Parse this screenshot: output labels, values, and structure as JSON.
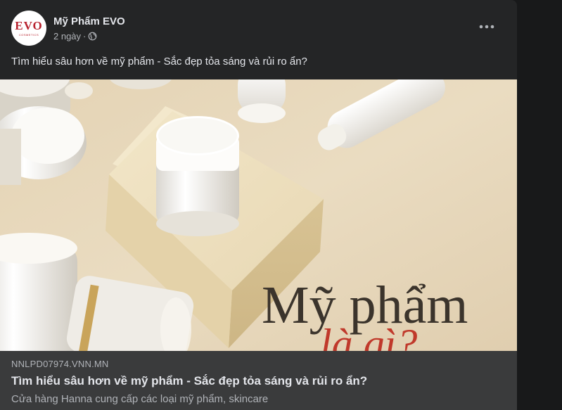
{
  "post": {
    "page_name": "Mỹ Phẩm EVO",
    "time": "2 ngày",
    "separator": "·",
    "audience_icon": "globe-icon",
    "more_icon": "more-horizontal-icon",
    "text": "Tìm hiểu sâu hơn về mỹ phẩm - Sắc đẹp tỏa sáng và rủi ro ẩn?",
    "avatar": {
      "logo": "EVO",
      "tagline": "COSMETICS",
      "color": "#b8232f"
    }
  },
  "image": {
    "headline": "Mỹ phẩm",
    "subheadline": "là gì?",
    "headline_color": "#3b342c",
    "subheadline_color": "#c0392b"
  },
  "link_preview": {
    "domain": "NNLPD07974.VNN.MN",
    "title": "Tìm hiểu sâu hơn về mỹ phẩm - Sắc đẹp tỏa sáng và rủi ro ẩn?",
    "description": "Cửa hàng Hanna cung cấp các loại mỹ phẩm, skincare"
  },
  "colors": {
    "card_bg": "#242526",
    "link_bg": "#3a3b3c",
    "page_bg": "#18191a",
    "primary_text": "#e4e6eb",
    "secondary_text": "#b0b3b8"
  }
}
